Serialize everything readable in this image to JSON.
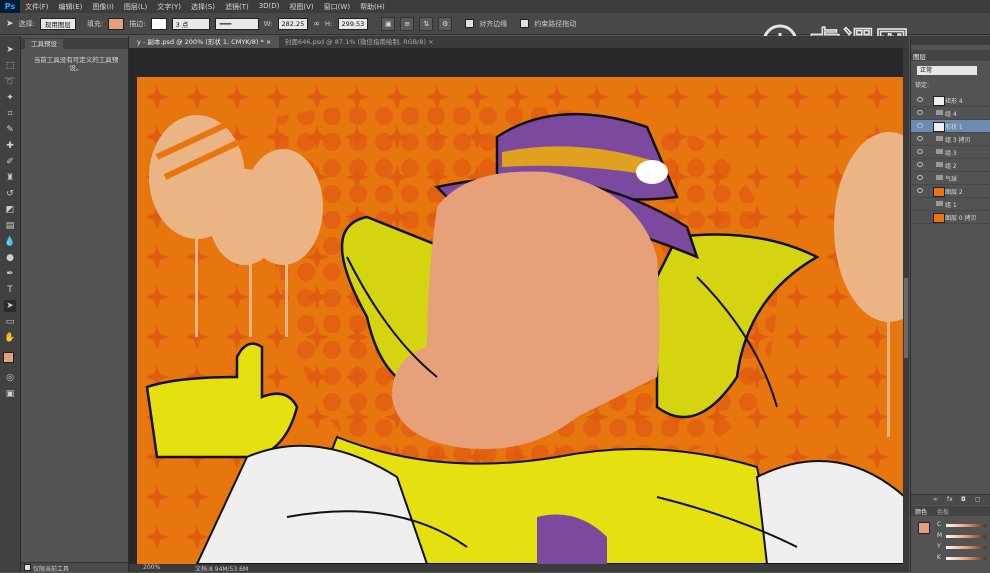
{
  "app": {
    "logo": "Ps"
  },
  "menu": [
    "文件(F)",
    "编辑(E)",
    "图像(I)",
    "图层(L)",
    "文字(Y)",
    "选择(S)",
    "滤镜(T)",
    "3D(D)",
    "视图(V)",
    "窗口(W)",
    "帮助(H)"
  ],
  "options": {
    "mode_label": "选择:",
    "mode_value": "现用图层",
    "fill_label": "填充:",
    "stroke_label": "描边:",
    "stroke_width": "3 点",
    "w_label": "W:",
    "w_value": "282.25",
    "h_label": "H:",
    "h_value": "299.53",
    "align_edges": "对齐边缘",
    "constrain": "约束路径拖动"
  },
  "colors": {
    "fill_swatch": "#e6a07a",
    "fg_color": "#e6a07a",
    "bg_color": "#ffffff",
    "orange": "#e8760f",
    "accent": "#31a8ff"
  },
  "tool_presets": {
    "tab": "工具预设",
    "message": "当前工具没有可定义的工具预设。",
    "footer": "仅限当前工具"
  },
  "doc_tabs": [
    {
      "label": "y - 副本.psd @ 200% (形状 1, CMYK/8) *"
    },
    {
      "label": "封面646.psd @ 87.1% (微信指南绘制, RGB/8)"
    }
  ],
  "status": {
    "zoom": "200%",
    "doc": "文档:8.94M/53.6M"
  },
  "layers_panel": {
    "tab": "图层",
    "blend": "正常",
    "lock_label": "锁定:",
    "layers": [
      {
        "name": "矩形 4",
        "visible": true,
        "kind": "shape"
      },
      {
        "name": "组 4",
        "visible": true,
        "kind": "group"
      },
      {
        "name": "形状 1",
        "visible": true,
        "kind": "shape",
        "selected": true
      },
      {
        "name": "组 3 拷贝",
        "visible": true,
        "kind": "group"
      },
      {
        "name": "组 3",
        "visible": true,
        "kind": "group"
      },
      {
        "name": "组 2",
        "visible": true,
        "kind": "group"
      },
      {
        "name": "气球",
        "visible": true,
        "kind": "group"
      },
      {
        "name": "图层 2",
        "visible": true,
        "kind": "pixel"
      },
      {
        "name": "组 1",
        "visible": false,
        "kind": "group"
      },
      {
        "name": "图层 0 拷贝",
        "visible": false,
        "kind": "pixel"
      }
    ]
  },
  "color_panel": {
    "tabs": [
      "颜色",
      "色板"
    ],
    "channels": [
      "C",
      "M",
      "Y",
      "K"
    ]
  },
  "watermark": {
    "text": "虎课网"
  }
}
